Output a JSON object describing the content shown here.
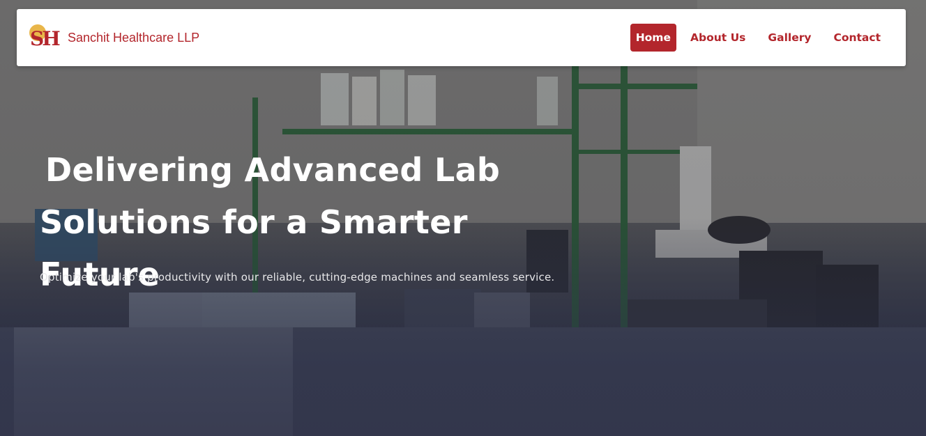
{
  "brand": {
    "logo_text": "SH",
    "name": "Sanchit Healthcare LLP"
  },
  "nav": {
    "items": [
      {
        "label": "Home",
        "active": true
      },
      {
        "label": "About Us",
        "active": false
      },
      {
        "label": "Gallery",
        "active": false
      },
      {
        "label": "Contact",
        "active": false
      }
    ]
  },
  "hero": {
    "headline_line1": "Delivering Advanced Lab",
    "headline_line2": "Solutions for a Smarter Future",
    "subtitle": "Optimize your lab's productivity with our reliable, cutting-edge machines and seamless service."
  },
  "colors": {
    "brand_red": "#b3262c",
    "logo_sun": "#e9b64a",
    "navbar_bg": "#ffffff",
    "hero_text": "#ffffff"
  }
}
